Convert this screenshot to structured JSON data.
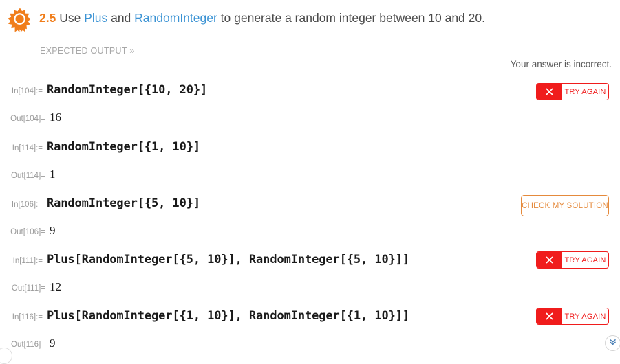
{
  "header": {
    "badge_icon": "award-rosette-icon",
    "problem_number": "2.5",
    "text_before_first_link": " Use ",
    "link1": "Plus",
    "text_between_links": " and ",
    "link2": "RandomInteger",
    "text_after_links": " to generate a random integer between 10 and 20.",
    "accent_orange": "#f07d1a",
    "link_blue": "#3b93d4"
  },
  "expected_output": {
    "label": "EXPECTED OUTPUT",
    "chevron": "»"
  },
  "status": {
    "message": "Your answer is incorrect."
  },
  "buttons": {
    "try_again_label": "TRY AGAIN",
    "check_solution_label": "CHECK MY SOLUTION",
    "try_again_color": "#f01c1c",
    "check_solution_color": "#e58a3c",
    "x_icon": "close-x-icon"
  },
  "scroll_down": {
    "icon": "double-chevron-down-icon"
  },
  "cells": [
    {
      "in_label": "In[104]:=",
      "code": "RandomInteger[{10, 20}]",
      "out_label": "Out[104]=",
      "result": "16",
      "button": "try-again"
    },
    {
      "in_label": "In[114]:=",
      "code": "RandomInteger[{1, 10}]",
      "out_label": "Out[114]=",
      "result": "1",
      "button": "check-solution"
    },
    {
      "in_label": "In[106]:=",
      "code": "RandomInteger[{5, 10}]",
      "out_label": "Out[106]=",
      "result": "9",
      "button": "check-solution"
    },
    {
      "in_label": "In[111]:=",
      "code": "Plus[RandomInteger[{5, 10}], RandomInteger[{5, 10}]]",
      "out_label": "Out[111]=",
      "result": "12",
      "button": "try-again"
    },
    {
      "in_label": "In[116]:=",
      "code": "Plus[RandomInteger[{1, 10}], RandomInteger[{1, 10}]]",
      "out_label": "Out[116]=",
      "result": "9",
      "button": "try-again"
    }
  ]
}
